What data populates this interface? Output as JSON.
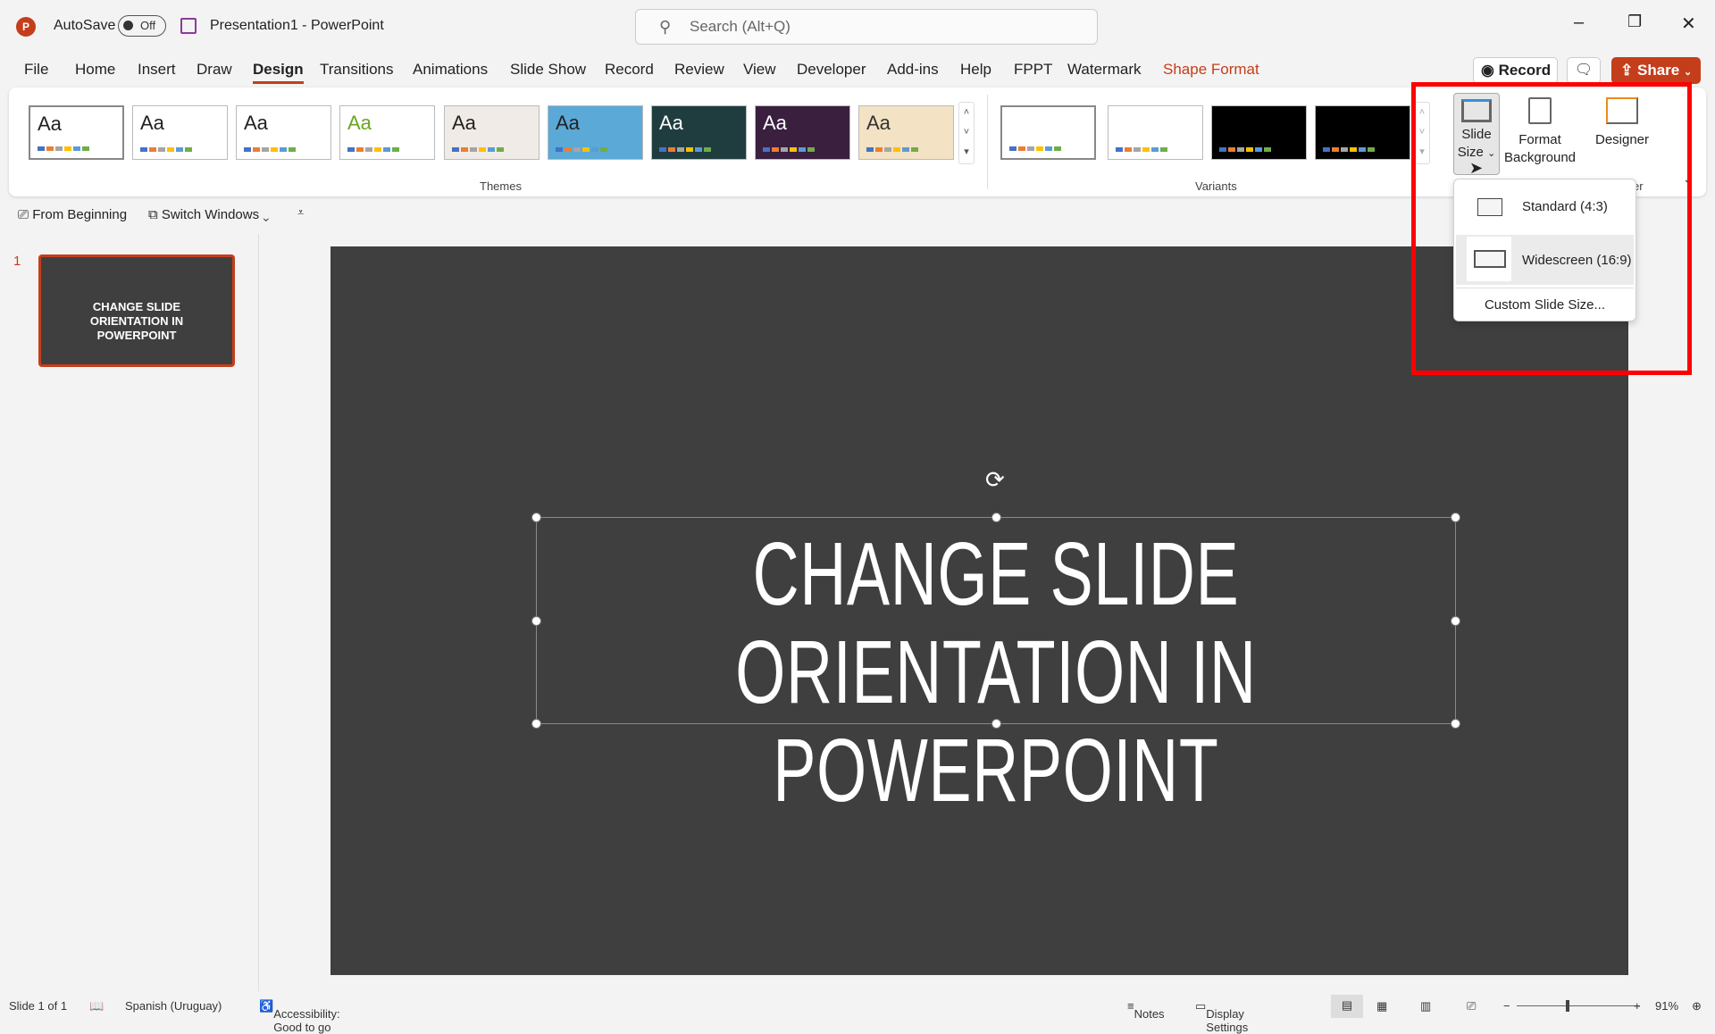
{
  "titlebar": {
    "autosave": "AutoSave",
    "autosave_state": "Off",
    "doc_title": "Presentation1  -  PowerPoint",
    "search_placeholder": "Search (Alt+Q)"
  },
  "tabs": [
    "File",
    "Home",
    "Insert",
    "Draw",
    "Design",
    "Transitions",
    "Animations",
    "Slide Show",
    "Record",
    "Review",
    "View",
    "Developer",
    "Add-ins",
    "Help",
    "FPPT",
    "Watermark",
    "Shape Format"
  ],
  "active_tab": "Design",
  "actions": {
    "record": "Record",
    "share": "Share"
  },
  "ribbon": {
    "theme_label": "Aa",
    "themes_group": "Themes",
    "variants_group": "Variants",
    "slide_size": "Slide Size",
    "format_background": "Format Background",
    "designer": "Designer",
    "designer_group_partial": "er"
  },
  "qat": {
    "from_beginning": "From Beginning",
    "switch_windows": "Switch Windows"
  },
  "slides": {
    "number": "1",
    "thumb_text": "CHANGE SLIDE ORIENTATION IN POWERPOINT"
  },
  "slide": {
    "title_line1": "CHANGE SLIDE",
    "title_line2": "ORIENTATION IN POWERPOINT"
  },
  "dropdown": {
    "standard": "Standard (4:3)",
    "widescreen": "Widescreen (16:9)",
    "custom": "Custom Slide Size..."
  },
  "status": {
    "slide": "Slide 1 of 1",
    "language": "Spanish (Uruguay)",
    "accessibility": "Accessibility: Good to go",
    "notes": "Notes",
    "display_settings": "Display Settings",
    "zoom": "91%"
  },
  "colors": {
    "accent": "#c43e1c",
    "highlight_box": "#ff0000",
    "slide_bg": "#3f3f3f"
  }
}
